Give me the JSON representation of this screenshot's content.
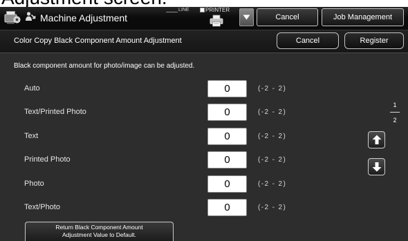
{
  "document": {
    "caption": "Adjustment screen."
  },
  "header": {
    "title": "Machine Adjustment",
    "line_label": "LINE",
    "printer_label": "PRINTER",
    "cancel_label": "Cancel",
    "job_management_label": "Job Management"
  },
  "subheader": {
    "title": "Color Copy Black Component Amount Adjustment",
    "cancel_label": "Cancel",
    "register_label": "Register"
  },
  "main": {
    "description": "Black component amount for photo/image can be adjusted.",
    "rows": [
      {
        "label": "Auto",
        "value": "0",
        "range": "(-2 - 2)"
      },
      {
        "label": "Text/Printed Photo",
        "value": "0",
        "range": "(-2 - 2)"
      },
      {
        "label": "Text",
        "value": "0",
        "range": "(-2 - 2)"
      },
      {
        "label": "Printed Photo",
        "value": "0",
        "range": "(-2 - 2)"
      },
      {
        "label": "Photo",
        "value": "0",
        "range": "(-2 - 2)"
      },
      {
        "label": "Text/Photo",
        "value": "0",
        "range": "(-2 - 2)"
      }
    ],
    "pager": {
      "current": "1",
      "total": "2"
    },
    "reset_button": {
      "line1": "Return Black Component Amount",
      "line2": "Adjustment Value to Default."
    }
  },
  "icons": {
    "app": "machine-adjustment-icon",
    "mode": "administrator-icon",
    "printer": "printer-icon",
    "dropdown": "triangle-down-icon",
    "page_up": "arrow-up-icon",
    "page_down": "arrow-down-icon"
  },
  "colors": {
    "header_bg": "#0b0b0b",
    "subheader_bg": "#161616",
    "screen_bg": "#2d2d2d",
    "text_primary": "#ffffff",
    "value_box_bg": "#ffffff",
    "button_border": "#c4c4c4"
  }
}
